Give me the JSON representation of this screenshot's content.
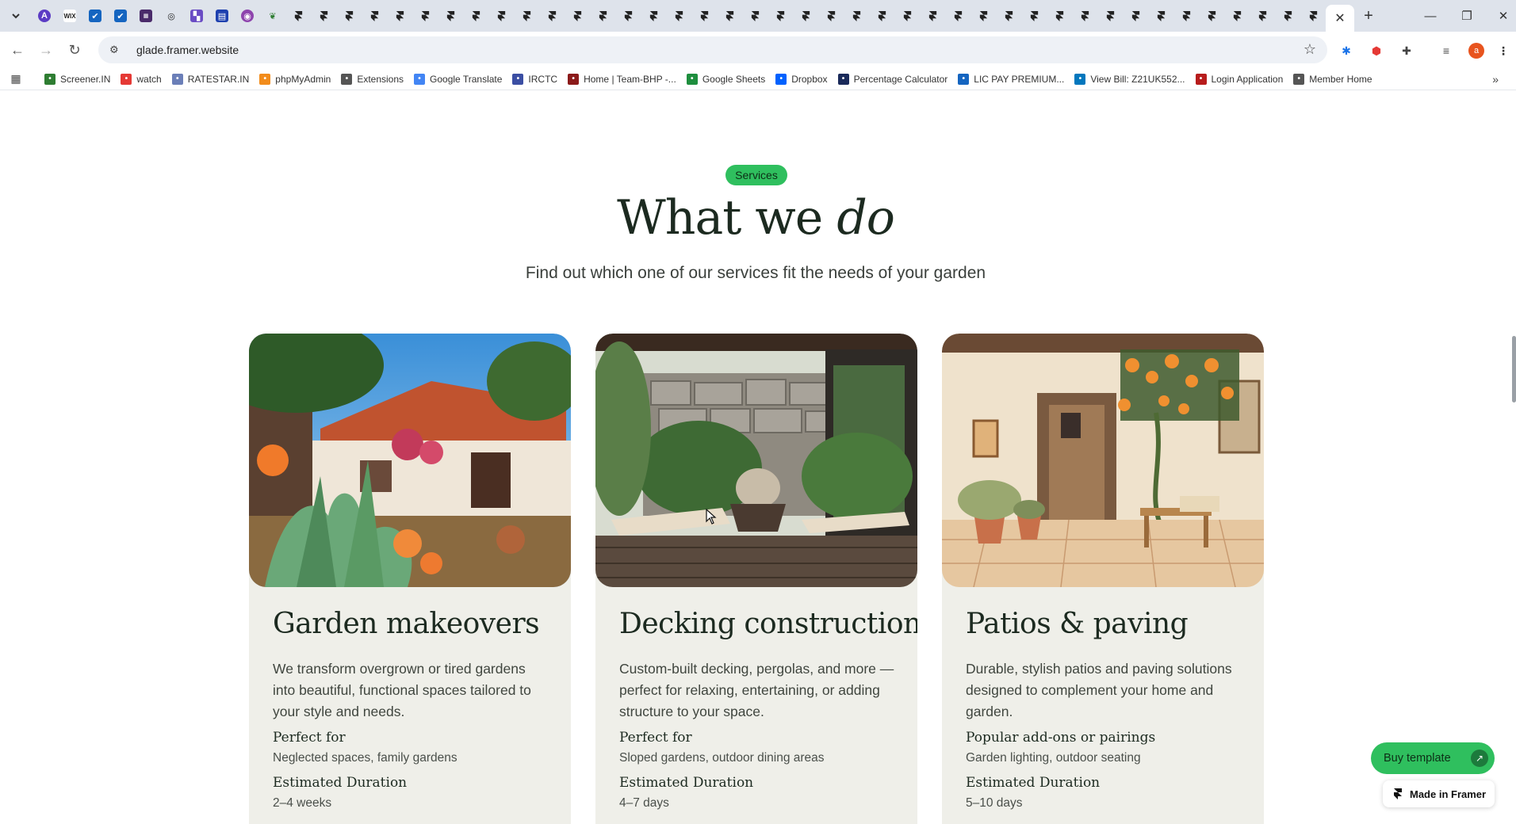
{
  "browser": {
    "tab_menu_icon": "chevron-down-icon",
    "tab_close": "✕",
    "new_tab": "+",
    "window_controls": [
      "—",
      "❐",
      "✕"
    ],
    "url": "glade.framer.website",
    "bookmarks": [
      {
        "label": "Screener.IN",
        "icon": "bar-chart-icon",
        "color": "#2e7d32"
      },
      {
        "label": "watch",
        "icon": "youtube-icon",
        "color": "#e53935"
      },
      {
        "label": "RATESTAR.IN",
        "icon": "ratestar-icon",
        "color": "#6b7fb8"
      },
      {
        "label": "phpMyAdmin",
        "icon": "phpmyadmin-icon",
        "color": "#f28c1c"
      },
      {
        "label": "Extensions",
        "icon": "puzzle-icon",
        "color": "#555555"
      },
      {
        "label": "Google Translate",
        "icon": "translate-icon",
        "color": "#4285f4"
      },
      {
        "label": "IRCTC",
        "icon": "irctc-icon",
        "color": "#3b4ea3"
      },
      {
        "label": "Home | Team-BHP -...",
        "icon": "teambhp-icon",
        "color": "#8b1a1a"
      },
      {
        "label": "Google Sheets",
        "icon": "sheets-icon",
        "color": "#1e8e3e"
      },
      {
        "label": "Dropbox",
        "icon": "dropbox-icon",
        "color": "#0061fe"
      },
      {
        "label": "Percentage Calculator",
        "icon": "percent-icon",
        "color": "#1a2a5a"
      },
      {
        "label": "LIC PAY PREMIUM...",
        "icon": "lic-icon",
        "color": "#1565c0"
      },
      {
        "label": "View Bill: Z21UK552...",
        "icon": "bill-icon",
        "color": "#0277bd"
      },
      {
        "label": "Login Application",
        "icon": "login-icon",
        "color": "#b71c1c"
      },
      {
        "label": "Member Home",
        "icon": "globe-icon",
        "color": "#555555"
      }
    ],
    "more_bookmarks": "»"
  },
  "page": {
    "badge": "Services",
    "heading_plain": "What we ",
    "heading_italic": "do",
    "subheading": "Find out which one of our services fit the needs of your garden",
    "cards": [
      {
        "title": "Garden makeovers",
        "description": "We transform overgrown or tired gardens into beautiful, functional spaces tailored to your style and needs.",
        "meta1_label": "Perfect for",
        "meta1_value": "Neglected spaces, family gardens",
        "meta2_label": "Estimated Duration",
        "meta2_value": "2–4 weeks"
      },
      {
        "title": "Decking construction",
        "description": "Custom-built decking, pergolas, and more — perfect for relaxing, entertaining, or adding structure to your space.",
        "meta1_label": "Perfect for",
        "meta1_value": "Sloped gardens, outdoor dining areas",
        "meta2_label": "Estimated Duration",
        "meta2_value": "4–7 days"
      },
      {
        "title": "Patios & paving",
        "description": "Durable, stylish patios and paving solutions designed to complement your home and garden.",
        "meta1_label": "Popular add-ons or pairings",
        "meta1_value": "Garden lighting, outdoor seating",
        "meta2_label": "Estimated Duration",
        "meta2_value": "5–10 days"
      }
    ],
    "buy_template": "Buy template",
    "made_in_framer": "Made in Framer"
  },
  "colors": {
    "accent_green": "#2fbf5e",
    "card_bg": "#efefe9",
    "heading": "#1c2a20"
  }
}
